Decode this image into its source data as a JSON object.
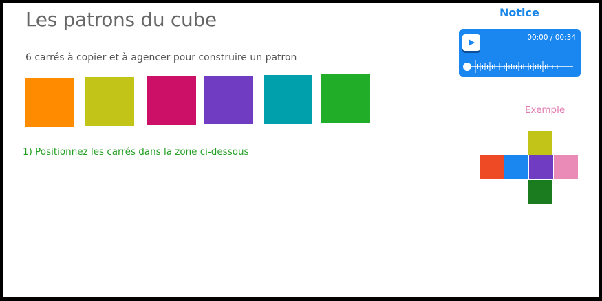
{
  "page": {
    "title": "Les patrons du cube",
    "subtitle": "6 carrés à copier et à agencer pour construire un patron",
    "instruction": "1) Positionnez les carrés dans la zone ci-dessous"
  },
  "squares": [
    {
      "name": "orange-square",
      "color": "#ff8c00"
    },
    {
      "name": "olive-square",
      "color": "#c2c417"
    },
    {
      "name": "magenta-square",
      "color": "#cc1068"
    },
    {
      "name": "purple-square",
      "color": "#6f3cc2"
    },
    {
      "name": "teal-square",
      "color": "#00a0ad"
    },
    {
      "name": "green-square",
      "color": "#21ad28"
    }
  ],
  "notice": {
    "title": "Notice",
    "player": {
      "time": "00:00 / 00:34",
      "play_icon": "play-icon",
      "progress": 0
    }
  },
  "example": {
    "label": "Exemple",
    "cells": [
      {
        "name": "net-top-olive",
        "color": "#c2c417"
      },
      {
        "name": "net-left-red",
        "color": "#ee4a25"
      },
      {
        "name": "net-blue",
        "color": "#1a86ef"
      },
      {
        "name": "net-center-purple",
        "color": "#6f3cc2"
      },
      {
        "name": "net-right-pink",
        "color": "#e98bb6"
      },
      {
        "name": "net-bottom-green",
        "color": "#1a7b1f"
      }
    ]
  },
  "colors": {
    "title": "#666666",
    "instruction": "#23a023",
    "notice": "#1a86e8",
    "player_bg": "#1a86f0",
    "example_label": "#e07bb0"
  }
}
